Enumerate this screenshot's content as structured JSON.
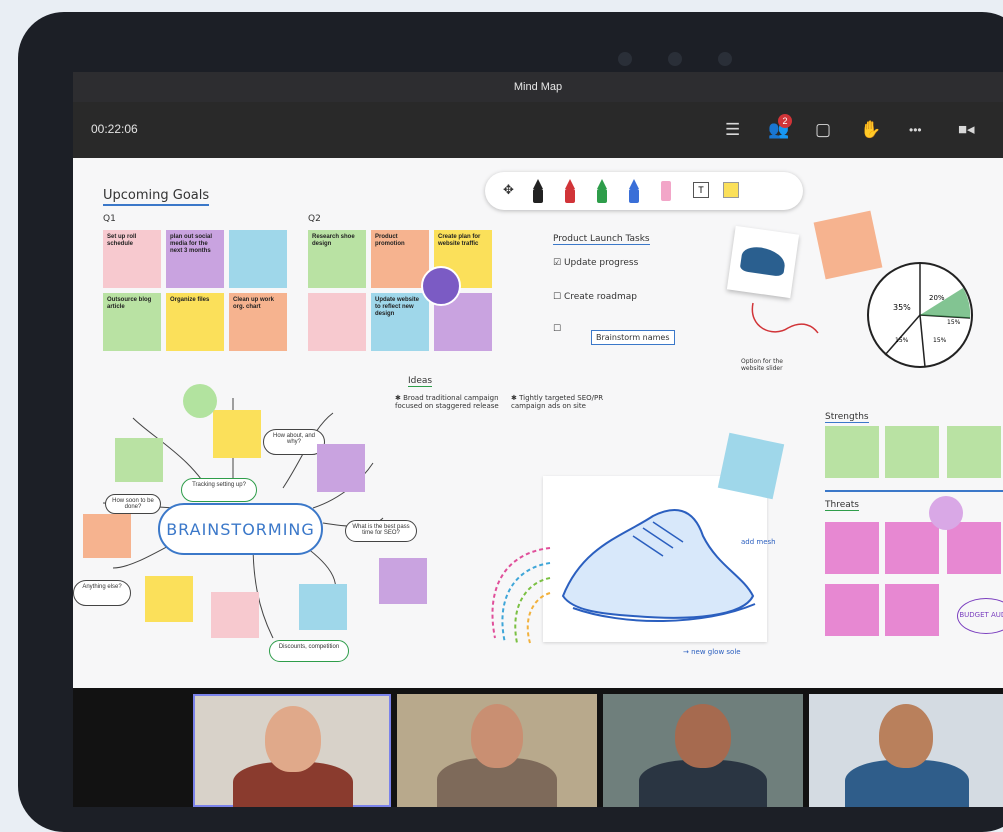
{
  "window": {
    "title": "Mind Map"
  },
  "toolbar": {
    "timer": "00:22:06",
    "participants_badge": "2",
    "icons": [
      "list-icon",
      "participants-icon",
      "chat-icon",
      "raise-hand-icon",
      "more-icon",
      "camera-icon"
    ],
    "more_label": "•••"
  },
  "board": {
    "upcoming_goals": {
      "title": "Upcoming Goals",
      "q1_label": "Q1",
      "q2_label": "Q2",
      "q1_notes": [
        "Set up roll schedule",
        "plan out social media for the next 3 months",
        "",
        "Outsource blog article",
        "Organize files",
        "Clean up work org. chart"
      ],
      "q2_notes": [
        "Research shoe design",
        "Product promotion",
        "Create plan for website traffic",
        "",
        "Update website to reflect new design",
        ""
      ]
    },
    "tasks": {
      "title": "Product Launch Tasks",
      "items": [
        "Update progress",
        "Create roadmap",
        "Brainstorm names"
      ]
    },
    "ideas": {
      "title": "Ideas",
      "items": [
        "Broad traditional campaign focused on staggered release",
        "Tightly targeted SEO/PR campaign ads on site"
      ]
    },
    "mindmap": {
      "center": "BRAINSTORMING",
      "nodes": [
        "How about, and why?",
        "What is the best pass time for SEO?",
        "How soon to be done?",
        "Tracking setting up?",
        "Anything else?",
        "Discounts, competition"
      ]
    },
    "strengths": {
      "title": "Strengths"
    },
    "threats": {
      "title": "Threats"
    },
    "pie": {
      "labels": [
        "35%",
        "20%",
        "15%",
        "15%",
        "15%"
      ]
    },
    "annotations": {
      "shoe_caption": "Option for the website slider",
      "sketch_note_a": "add mesh",
      "sketch_note_b": "→ new glow sole",
      "bubble": "BUDGET AUDIT"
    },
    "pen_tools": {
      "colors": [
        "#222222",
        "#d13438",
        "#2e9d4a",
        "#3a6fd8",
        "#f2a6c8"
      ],
      "text_tool": "T"
    }
  },
  "colors": {
    "note_pink": "#f7c9cf",
    "note_purple": "#c9a3e0",
    "note_blue": "#9fd7ea",
    "note_green": "#b9e2a3",
    "note_yellow": "#fbe05a",
    "note_orange": "#f6b38f",
    "accent_blue": "#3b78c9"
  }
}
